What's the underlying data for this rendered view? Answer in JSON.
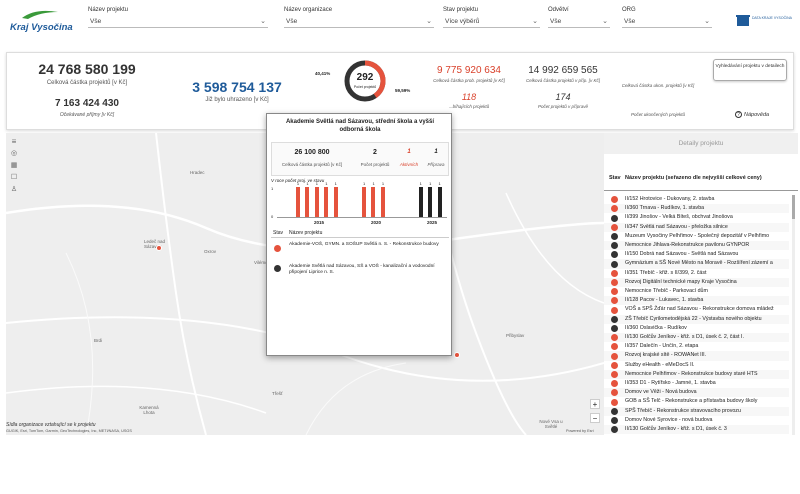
{
  "header": {
    "logo_text": "Kraj Vysočina",
    "filters": [
      {
        "label": "Název projektu",
        "value": "Vše"
      },
      {
        "label": "Název organizace",
        "value": "Vše"
      },
      {
        "label": "Stav projektu",
        "value": "Více výběrů"
      },
      {
        "label": "Odvětví",
        "value": "Vše"
      },
      {
        "label": "ORG",
        "value": "Vše"
      }
    ],
    "data_logo": "DATA KRAJE VYSOČINA"
  },
  "kpis": {
    "total_amount": "24 768 580 199",
    "total_amount_label": "Celková částka projektů [v Kč]",
    "expected_income": "7 163 424 430",
    "expected_income_label": "Očekávané příjmy [v Kč]",
    "paid": "3 598 754 137",
    "paid_label": "Již bylo uhrazeno [v Kč]",
    "donut_left_pct": "40,41%",
    "donut_right_pct": "59,59%",
    "donut_value": "292",
    "donut_label": "Počet projektů",
    "donut_red_fraction": 0.4041,
    "active_amount": "9 775 920 634",
    "active_amount_label": "Celková částka prob. projektů [v Kč]",
    "active_count": "118",
    "active_count_label": "...bíhajících projektů",
    "prep_amount": "14 992 659 565",
    "prep_amount_label": "Celková částka projektů v příp. [v Kč]",
    "prep_count": "174",
    "prep_count_label": "Počet projektů v přípravě",
    "done_amount_label": "Celková částka ukon. projektů [v Kč]",
    "done_count_label": "Počet ukončených projektů",
    "reset_button": "Vyhledávání projektu v detailech",
    "help_label": "Nápověda"
  },
  "popup": {
    "title": "Akademie Světlá nad Sázavou, střední škola a vyšší odborná škola",
    "amount": "26 100 800",
    "amount_label": "Celková částka projektů [v Kč]",
    "count": "2",
    "count_label": "Počet projektů",
    "active": "1",
    "active_label": "Aktivních",
    "prep": "1",
    "prep_label": "Příprava",
    "chart_title": "V roce počet proj. ve stavu",
    "x_ticks": [
      "2015",
      "2020",
      "2025"
    ],
    "y_ticks": [
      "1",
      "0"
    ],
    "col_stav": "Stav",
    "col_name": "Název projektu",
    "rows": [
      {
        "status": "active",
        "name": "Akademie-VOŠ, GYMN. a SOŠUP Světlá n. S. - Rekonstrukce budovy"
      },
      {
        "status": "prep",
        "name": "Akademie Světlá nad Sázavou, SŠ a VOŠ - kanalizační a vodovodní připojení Liprice n. S."
      }
    ]
  },
  "chart_data": {
    "type": "bar",
    "title": "V roce počet proj. ve stavu",
    "x": [
      2012,
      2013,
      2014,
      2015,
      2016,
      2019,
      2020,
      2021,
      2025,
      2026,
      2027
    ],
    "series": [
      {
        "values": [
          1,
          1,
          1,
          1,
          1,
          1,
          1,
          1,
          1,
          1,
          1
        ]
      }
    ],
    "bar_status": [
      "active",
      "active",
      "active",
      "active",
      "active",
      "active",
      "active",
      "active",
      "prep",
      "prep",
      "prep"
    ],
    "data_labels": [
      "1",
      "1",
      "1",
      "1",
      "1",
      "1",
      "1",
      "1",
      "1",
      "1",
      "1"
    ],
    "ylim": [
      0,
      1
    ]
  },
  "map": {
    "labels": [
      "Hradec",
      "Ledeč nad Sázavou",
      "Oxrov",
      "Vilémov",
      "Batelov",
      "Telč",
      "Brdi",
      "Třešť",
      "Pelhřimov",
      "Kamenná Lhota",
      "Přibyslav",
      "Nové Veselí",
      "Nové Vsa u Světlé"
    ],
    "footer_title": "Sídla organizace vztahující se k projektu",
    "attribution": "GUGIK, Esri, TomTom, Garmin, GeoTechnologies, Inc, METI/NASA, USGS",
    "powered": "Powered by Esri",
    "zoom_in": "+",
    "zoom_out": "−"
  },
  "detail": {
    "button": "Detaily projektu",
    "col_stav": "Stav",
    "col_name": "Název projektu (seřazeno dle nejvyšší celkové ceny)",
    "rows": [
      {
        "s": "active",
        "name": "II/152 Hrotovice - Dukovany, 2. stavba"
      },
      {
        "s": "active",
        "name": "II/360 Trnava - Rudíkov, 1. stavba"
      },
      {
        "s": "prep",
        "name": "II/399 Jinošov - Velká Bíteš, obchvat Jinošova"
      },
      {
        "s": "active",
        "name": "II/347 Světlá nad Sázavou - přeložka silnice"
      },
      {
        "s": "prep",
        "name": "Muzeum Vysočiny Pelhřimov - Společný depozitář v Pelhřimo"
      },
      {
        "s": "prep",
        "name": "Nemocnice Jihlava-Rekonstrukce pavilonu GYNPOR"
      },
      {
        "s": "prep",
        "name": "II/150 Dobrá nad Sázavou - Světlá nad Sázavou"
      },
      {
        "s": "prep",
        "name": "Gymnázium a SŠ Nové Město na Moravě - Rozšíření zázemí a"
      },
      {
        "s": "active",
        "name": "II/351 Třebíč - křiž. s II/399, 2. část"
      },
      {
        "s": "active",
        "name": "Rozvoj Digitální technické mapy Kraje Vysočina"
      },
      {
        "s": "active",
        "name": "Nemocnice Třebíč - Parkovací dům"
      },
      {
        "s": "active",
        "name": "II/128 Pacov - Lukavec, 1. stavba"
      },
      {
        "s": "active",
        "name": "VOŠ a SPŠ Žďár nad Sázavou - Rekonstrukce domova mládež"
      },
      {
        "s": "prep",
        "name": "ZŠ Třebíč Cyrilometodějská 22 - Výstavba nového objektu"
      },
      {
        "s": "prep",
        "name": "II/360 Oslavička - Rudíkov"
      },
      {
        "s": "active",
        "name": "II/130 Golčův Jeníkov - křiž. s D1, úsek č. 2, část I."
      },
      {
        "s": "active",
        "name": "II/357 Dalečín - Unčín, 2. etapa"
      },
      {
        "s": "active",
        "name": "Rozvoj krajské sítě - ROWANet III."
      },
      {
        "s": "active",
        "name": "Služby eHealth - eMeDocS II."
      },
      {
        "s": "active",
        "name": "Nemocnice Pelhřimov - Rekonstrukce budovy staré HTS"
      },
      {
        "s": "active",
        "name": "II/353 D1 - Rytířsko - Jamné, 1. stavba"
      },
      {
        "s": "active",
        "name": "Domov ve Věži - Nová budova"
      },
      {
        "s": "active",
        "name": "GOB a SŠ Telč - Rekonstrukce a přístavba budovy školy"
      },
      {
        "s": "prep",
        "name": "SPŠ Třebíč - Rekonstrukce stravovacího provozu"
      },
      {
        "s": "prep",
        "name": "Domov Nové Syrovice - nová budova"
      },
      {
        "s": "prep",
        "name": "II/130 Golčův Jeníkov - křiž. s D1, úsek č. 3"
      }
    ]
  },
  "colors": {
    "active": "#e5533d",
    "prep": "#222222",
    "kpi_blue": "#1f5b9a",
    "accent": "#d9412b"
  }
}
